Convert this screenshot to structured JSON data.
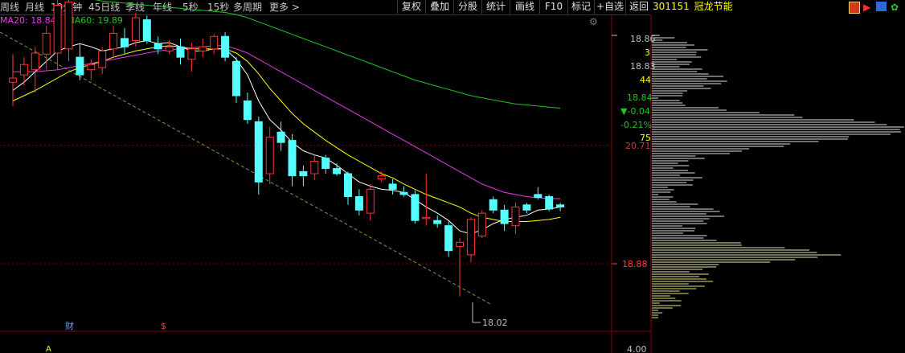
{
  "toolbar": {
    "periods": [
      "周线",
      "月线",
      "10分钟",
      "45日线",
      "季线",
      "年线",
      "5秒",
      "15秒",
      "多周期",
      "更多 >"
    ],
    "buttons": [
      "复权",
      "叠加",
      "分股",
      "统计",
      "画线",
      "F10",
      "标记",
      "+自选",
      "返回"
    ]
  },
  "stock_title": {
    "code": "301151",
    "name": "冠龙节能"
  },
  "legend": {
    "ma20": {
      "label": "MA20: 18.84",
      "color": "#e83ce8"
    },
    "ma60": {
      "label": "MA60: 19.89",
      "color": "#22c322"
    }
  },
  "price_axis": {
    "ticks": [
      "18.86",
      "3",
      "18.83",
      "44",
      "18.84",
      "▼-0.04",
      "-0.21%",
      "75",
      "20.71",
      "18.88",
      "4.00"
    ],
    "current_price": "18.88",
    "low_label": "18.02"
  },
  "markers": {
    "cai": "财",
    "s": "$",
    "tri": "A"
  },
  "colors": {
    "up": "#ff3333",
    "down": "#54ffff",
    "ma5": "#ffffff",
    "ma10": "#ffff00",
    "ma20": "#e83ce8",
    "ma60": "#22c322",
    "grid": "#8b0000"
  },
  "chart_data": {
    "type": "candlestick",
    "title": "冠龙节能 301151",
    "ylabel": "",
    "ylim": [
      17.9,
      20.9
    ],
    "candles": [
      {
        "o": 20.28,
        "h": 20.55,
        "l": 20.05,
        "c": 20.32,
        "d": "up"
      },
      {
        "o": 20.35,
        "h": 20.52,
        "l": 20.25,
        "c": 20.45,
        "d": "up"
      },
      {
        "o": 20.4,
        "h": 20.62,
        "l": 20.18,
        "c": 20.56,
        "d": "up"
      },
      {
        "o": 20.55,
        "h": 20.82,
        "l": 20.4,
        "c": 20.75,
        "d": "up"
      },
      {
        "o": 20.56,
        "h": 21.12,
        "l": 20.4,
        "c": 21.02,
        "d": "up"
      },
      {
        "o": 20.6,
        "h": 21.08,
        "l": 20.48,
        "c": 21.05,
        "d": "up"
      },
      {
        "o": 20.52,
        "h": 20.65,
        "l": 20.3,
        "c": 20.35,
        "d": "down"
      },
      {
        "o": 20.4,
        "h": 20.5,
        "l": 20.3,
        "c": 20.45,
        "d": "up"
      },
      {
        "o": 20.42,
        "h": 20.62,
        "l": 20.36,
        "c": 20.58,
        "d": "up"
      },
      {
        "o": 20.6,
        "h": 20.82,
        "l": 20.52,
        "c": 20.75,
        "d": "up"
      },
      {
        "o": 20.7,
        "h": 20.8,
        "l": 20.55,
        "c": 20.62,
        "d": "down"
      },
      {
        "o": 20.68,
        "h": 20.95,
        "l": 20.62,
        "c": 20.9,
        "d": "up"
      },
      {
        "o": 20.88,
        "h": 20.92,
        "l": 20.65,
        "c": 20.68,
        "d": "down"
      },
      {
        "o": 20.65,
        "h": 20.72,
        "l": 20.55,
        "c": 20.6,
        "d": "down"
      },
      {
        "o": 20.58,
        "h": 20.68,
        "l": 20.55,
        "c": 20.62,
        "d": "up"
      },
      {
        "o": 20.62,
        "h": 20.7,
        "l": 20.45,
        "c": 20.52,
        "d": "down"
      },
      {
        "o": 20.5,
        "h": 20.66,
        "l": 20.38,
        "c": 20.6,
        "d": "up"
      },
      {
        "o": 20.58,
        "h": 20.7,
        "l": 20.52,
        "c": 20.62,
        "d": "up"
      },
      {
        "o": 20.6,
        "h": 20.74,
        "l": 20.55,
        "c": 20.72,
        "d": "up"
      },
      {
        "o": 20.72,
        "h": 20.76,
        "l": 20.48,
        "c": 20.52,
        "d": "down"
      },
      {
        "o": 20.48,
        "h": 20.52,
        "l": 20.08,
        "c": 20.15,
        "d": "down"
      },
      {
        "o": 20.1,
        "h": 20.18,
        "l": 19.88,
        "c": 19.92,
        "d": "down"
      },
      {
        "o": 19.9,
        "h": 19.95,
        "l": 19.2,
        "c": 19.32,
        "d": "down"
      },
      {
        "o": 19.4,
        "h": 19.85,
        "l": 19.3,
        "c": 19.75,
        "d": "up"
      },
      {
        "o": 19.7,
        "h": 19.9,
        "l": 19.62,
        "c": 19.8,
        "d": "down"
      },
      {
        "o": 19.72,
        "h": 19.78,
        "l": 19.28,
        "c": 19.38,
        "d": "down"
      },
      {
        "o": 19.38,
        "h": 19.48,
        "l": 19.28,
        "c": 19.42,
        "d": "down"
      },
      {
        "o": 19.4,
        "h": 19.58,
        "l": 19.34,
        "c": 19.52,
        "d": "up"
      },
      {
        "o": 19.55,
        "h": 19.58,
        "l": 19.4,
        "c": 19.45,
        "d": "down"
      },
      {
        "o": 19.45,
        "h": 19.5,
        "l": 19.38,
        "c": 19.4,
        "d": "down"
      },
      {
        "o": 19.4,
        "h": 19.42,
        "l": 19.1,
        "c": 19.18,
        "d": "down"
      },
      {
        "o": 19.18,
        "h": 19.25,
        "l": 19.0,
        "c": 19.05,
        "d": "down"
      },
      {
        "o": 19.02,
        "h": 19.3,
        "l": 18.95,
        "c": 19.25,
        "d": "up"
      },
      {
        "o": 19.35,
        "h": 19.42,
        "l": 19.32,
        "c": 19.38,
        "d": "up"
      },
      {
        "o": 19.3,
        "h": 19.35,
        "l": 19.2,
        "c": 19.25,
        "d": "down"
      },
      {
        "o": 19.22,
        "h": 19.28,
        "l": 19.18,
        "c": 19.2,
        "d": "down"
      },
      {
        "o": 19.2,
        "h": 19.24,
        "l": 18.92,
        "c": 18.95,
        "d": "down"
      },
      {
        "o": 18.98,
        "h": 19.4,
        "l": 18.9,
        "c": 18.98,
        "d": "up"
      },
      {
        "o": 18.95,
        "h": 19.0,
        "l": 18.88,
        "c": 18.92,
        "d": "down"
      },
      {
        "o": 18.9,
        "h": 18.94,
        "l": 18.6,
        "c": 18.66,
        "d": "down"
      },
      {
        "o": 18.7,
        "h": 18.78,
        "l": 18.22,
        "c": 18.74,
        "d": "up"
      },
      {
        "o": 18.62,
        "h": 18.98,
        "l": 18.55,
        "c": 18.96,
        "d": "up"
      },
      {
        "o": 18.8,
        "h": 19.05,
        "l": 18.78,
        "c": 19.02,
        "d": "up"
      },
      {
        "o": 19.15,
        "h": 19.18,
        "l": 19.02,
        "c": 19.05,
        "d": "down"
      },
      {
        "o": 19.05,
        "h": 19.1,
        "l": 18.85,
        "c": 18.92,
        "d": "down"
      },
      {
        "o": 18.9,
        "h": 19.12,
        "l": 18.82,
        "c": 19.08,
        "d": "up"
      },
      {
        "o": 19.1,
        "h": 19.12,
        "l": 19.02,
        "c": 19.05,
        "d": "down"
      },
      {
        "o": 19.2,
        "h": 19.27,
        "l": 19.15,
        "c": 19.17,
        "d": "down"
      },
      {
        "o": 19.18,
        "h": 19.2,
        "l": 19.04,
        "c": 19.06,
        "d": "down"
      },
      {
        "o": 19.1,
        "h": 19.12,
        "l": 19.04,
        "c": 19.08,
        "d": "down"
      }
    ],
    "ma5": [
      20.2,
      20.28,
      20.38,
      20.48,
      20.58,
      20.62,
      20.65,
      20.62,
      20.58,
      20.6,
      20.62,
      20.66,
      20.68,
      20.65,
      20.66,
      20.62,
      20.58,
      20.58,
      20.6,
      20.6,
      20.5,
      20.35,
      20.1,
      19.92,
      19.82,
      19.7,
      19.62,
      19.58,
      19.55,
      19.48,
      19.4,
      19.32,
      19.28,
      19.25,
      19.24,
      19.22,
      19.15,
      19.08,
      19.02,
      18.95,
      18.85,
      18.82,
      18.86,
      18.92,
      18.96,
      18.98,
      19.0,
      19.05,
      19.06,
      19.08
    ],
    "ma10": [
      20.1,
      20.15,
      20.2,
      20.26,
      20.32,
      20.38,
      20.42,
      20.45,
      20.48,
      20.52,
      20.55,
      20.58,
      20.6,
      20.62,
      20.63,
      20.62,
      20.6,
      20.6,
      20.6,
      20.6,
      20.56,
      20.48,
      20.36,
      20.22,
      20.1,
      19.98,
      19.88,
      19.8,
      19.72,
      19.65,
      19.58,
      19.52,
      19.46,
      19.4,
      19.36,
      19.3,
      19.25,
      19.2,
      19.16,
      19.12,
      19.08,
      19.02,
      18.98,
      18.96,
      18.94,
      18.94,
      18.94,
      18.95,
      18.96,
      18.98
    ],
    "ma20": [
      20.38,
      20.38,
      20.38,
      20.39,
      20.4,
      20.42,
      20.44,
      20.46,
      20.48,
      20.5,
      20.52,
      20.54,
      20.56,
      20.58,
      20.59,
      20.6,
      20.61,
      20.62,
      20.63,
      20.63,
      20.6,
      20.56,
      20.5,
      20.44,
      20.38,
      20.32,
      20.26,
      20.2,
      20.14,
      20.08,
      20.02,
      19.96,
      19.9,
      19.84,
      19.78,
      19.72,
      19.66,
      19.6,
      19.54,
      19.48,
      19.42,
      19.36,
      19.3,
      19.26,
      19.22,
      19.2,
      19.18,
      19.17,
      19.16,
      19.16
    ],
    "ma60": [
      21.28,
      21.24,
      21.2,
      21.17,
      21.14,
      21.12,
      21.1,
      21.08,
      21.06,
      21.05,
      21.04,
      21.03,
      21.02,
      21.01,
      21.0,
      20.99,
      20.98,
      20.97,
      20.96,
      20.95,
      20.93,
      20.9,
      20.86,
      20.82,
      20.78,
      20.74,
      20.7,
      20.66,
      20.62,
      20.58,
      20.54,
      20.5,
      20.46,
      20.42,
      20.38,
      20.34,
      20.3,
      20.27,
      20.24,
      20.21,
      20.18,
      20.15,
      20.13,
      20.11,
      20.09,
      20.07,
      20.06,
      20.05,
      20.04,
      20.03
    ]
  }
}
